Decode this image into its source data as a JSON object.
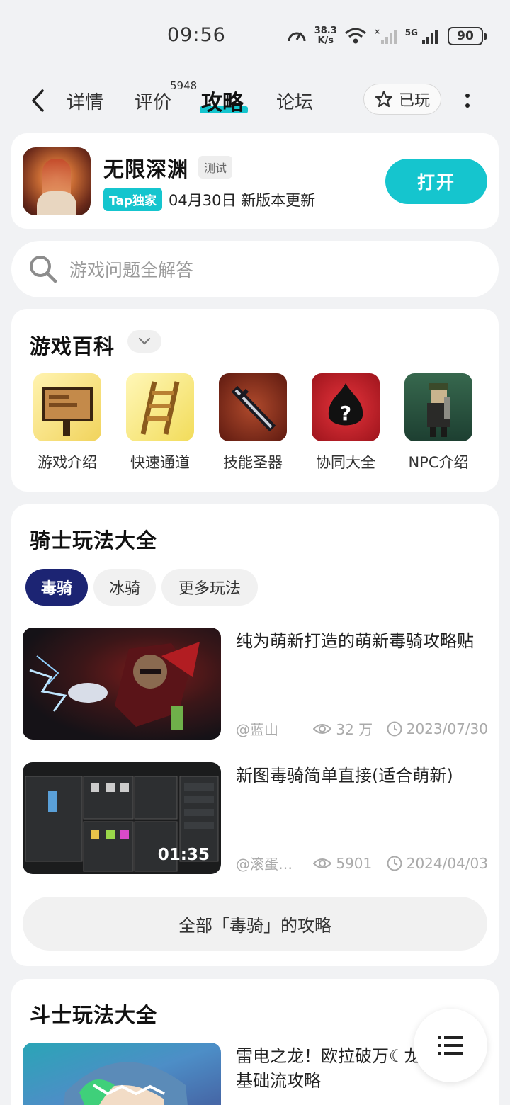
{
  "status_bar": {
    "time": "09:56",
    "net_speed_value": "38.3",
    "net_speed_unit": "K/s",
    "network": "5G",
    "battery": "90"
  },
  "nav": {
    "tabs": [
      {
        "label": "详情"
      },
      {
        "label": "评价",
        "count": "5948"
      },
      {
        "label": "攻略",
        "active": true
      },
      {
        "label": "论坛"
      }
    ],
    "played_label": "已玩"
  },
  "game": {
    "title": "无限深渊",
    "badge": "测试",
    "tap_badge": "Tap独家",
    "update": "04月30日 新版本更新",
    "open_label": "打开"
  },
  "search": {
    "placeholder": "游戏问题全解答"
  },
  "wiki": {
    "title": "游戏百科",
    "items": [
      {
        "label": "游戏介绍"
      },
      {
        "label": "快速通道"
      },
      {
        "label": "技能圣器"
      },
      {
        "label": "协同大全"
      },
      {
        "label": "NPC介绍"
      }
    ]
  },
  "knight": {
    "title": "骑士玩法大全",
    "chips": [
      {
        "label": "毒骑",
        "active": true
      },
      {
        "label": "冰骑"
      },
      {
        "label": "更多玩法"
      }
    ],
    "articles": [
      {
        "title": "纯为萌新打造的萌新毒骑攻略贴",
        "author": "@蓝山",
        "views": "32 万",
        "date": "2023/07/30"
      },
      {
        "title": "新图毒骑简单直接(适合萌新)",
        "author": "@滚蛋…",
        "views": "5901",
        "date": "2024/04/03",
        "duration": "01:35"
      }
    ],
    "all_label": "全部「毒骑」的攻略"
  },
  "fighter": {
    "title": "斗士玩法大全",
    "article_title": "雷电之龙！欧拉破万☾龙拳斗士基础流攻略"
  },
  "colors": {
    "accent": "#15c5ce",
    "chip_active": "#1c2473",
    "background": "#f1f2f4"
  }
}
